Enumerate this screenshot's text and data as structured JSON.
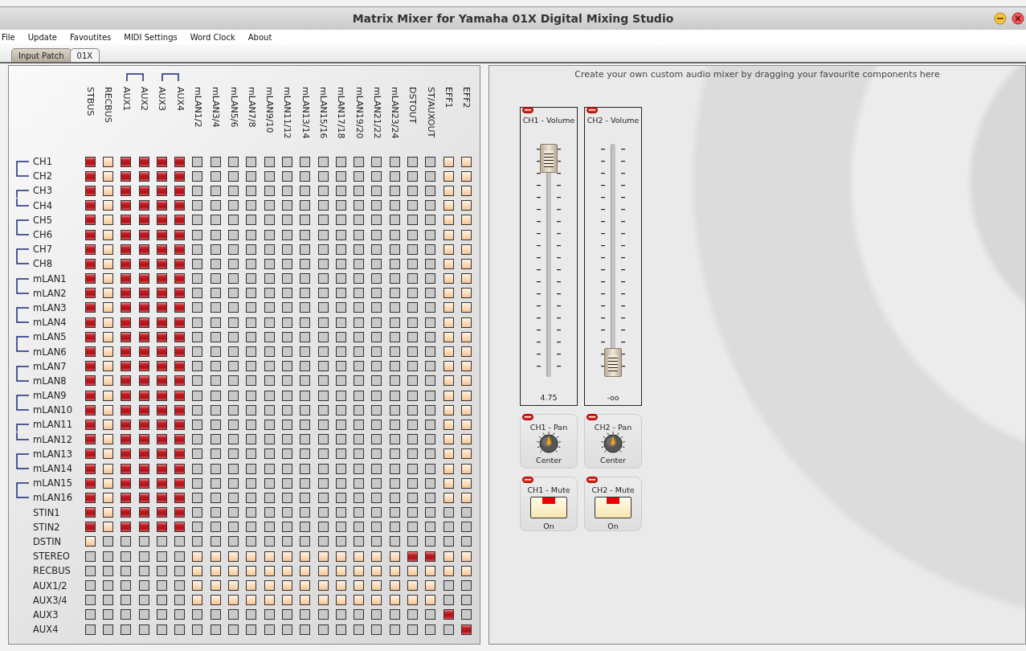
{
  "window": {
    "title": "Matrix Mixer for Yamaha 01X Digital Mixing Studio"
  },
  "menu": [
    "File",
    "Update",
    "Favoutites",
    "MIDI Settings",
    "Word Clock",
    "About"
  ],
  "tabs": [
    {
      "label": "Input Patch",
      "selected": false
    },
    {
      "label": "01X",
      "selected": true
    }
  ],
  "matrix": {
    "columns": [
      {
        "label": "STBUS",
        "linked": false
      },
      {
        "label": "RECBUS",
        "linked": false
      },
      {
        "label": "AUX1",
        "linked": true
      },
      {
        "label": "AUX2",
        "linked": true
      },
      {
        "label": "AUX3",
        "linked": true
      },
      {
        "label": "AUX4",
        "linked": true
      },
      {
        "label": "mLAN1/2",
        "linked": false
      },
      {
        "label": "mLAN3/4",
        "linked": false
      },
      {
        "label": "mLAN5/6",
        "linked": false
      },
      {
        "label": "mLAN7/8",
        "linked": false
      },
      {
        "label": "mLAN9/10",
        "linked": false
      },
      {
        "label": "mLAN11/12",
        "linked": false
      },
      {
        "label": "mLAN13/14",
        "linked": false
      },
      {
        "label": "mLAN15/16",
        "linked": false
      },
      {
        "label": "mLAN17/18",
        "linked": false
      },
      {
        "label": "mLAN19/20",
        "linked": false
      },
      {
        "label": "mLAN21/22",
        "linked": false
      },
      {
        "label": "mLAN23/24",
        "linked": false
      },
      {
        "label": "DSTOUT",
        "linked": false
      },
      {
        "label": "ST/AUXOUT",
        "linked": false
      },
      {
        "label": "EFF1",
        "linked": false
      },
      {
        "label": "EFF2",
        "linked": false
      }
    ],
    "rows": [
      {
        "label": "CH1",
        "linked": true,
        "on": [
          true,
          false,
          true,
          true,
          true,
          true,
          false,
          false,
          false,
          false,
          false,
          false,
          false,
          false,
          false,
          false,
          false,
          false,
          false,
          false,
          false,
          false
        ],
        "enabled": [
          true,
          true,
          true,
          true,
          true,
          true,
          false,
          false,
          false,
          false,
          false,
          false,
          false,
          false,
          false,
          false,
          false,
          false,
          false,
          false,
          true,
          true
        ]
      },
      {
        "label": "CH2",
        "linked": true,
        "on": [
          true,
          false,
          true,
          true,
          true,
          true,
          false,
          false,
          false,
          false,
          false,
          false,
          false,
          false,
          false,
          false,
          false,
          false,
          false,
          false,
          false,
          false
        ],
        "enabled": [
          true,
          true,
          true,
          true,
          true,
          true,
          false,
          false,
          false,
          false,
          false,
          false,
          false,
          false,
          false,
          false,
          false,
          false,
          false,
          false,
          true,
          true
        ]
      },
      {
        "label": "CH3",
        "linked": true,
        "on": [
          true,
          false,
          true,
          true,
          true,
          true,
          false,
          false,
          false,
          false,
          false,
          false,
          false,
          false,
          false,
          false,
          false,
          false,
          false,
          false,
          false,
          false
        ],
        "enabled": [
          true,
          true,
          true,
          true,
          true,
          true,
          false,
          false,
          false,
          false,
          false,
          false,
          false,
          false,
          false,
          false,
          false,
          false,
          false,
          false,
          true,
          true
        ]
      },
      {
        "label": "CH4",
        "linked": true,
        "on": [
          true,
          false,
          true,
          true,
          true,
          true,
          false,
          false,
          false,
          false,
          false,
          false,
          false,
          false,
          false,
          false,
          false,
          false,
          false,
          false,
          false,
          false
        ],
        "enabled": [
          true,
          true,
          true,
          true,
          true,
          true,
          false,
          false,
          false,
          false,
          false,
          false,
          false,
          false,
          false,
          false,
          false,
          false,
          false,
          false,
          true,
          true
        ]
      },
      {
        "label": "CH5",
        "linked": true,
        "on": [
          true,
          false,
          true,
          true,
          true,
          true,
          false,
          false,
          false,
          false,
          false,
          false,
          false,
          false,
          false,
          false,
          false,
          false,
          false,
          false,
          false,
          false
        ],
        "enabled": [
          true,
          true,
          true,
          true,
          true,
          true,
          false,
          false,
          false,
          false,
          false,
          false,
          false,
          false,
          false,
          false,
          false,
          false,
          false,
          false,
          true,
          true
        ]
      },
      {
        "label": "CH6",
        "linked": true,
        "on": [
          true,
          false,
          true,
          true,
          true,
          true,
          false,
          false,
          false,
          false,
          false,
          false,
          false,
          false,
          false,
          false,
          false,
          false,
          false,
          false,
          false,
          false
        ],
        "enabled": [
          true,
          true,
          true,
          true,
          true,
          true,
          false,
          false,
          false,
          false,
          false,
          false,
          false,
          false,
          false,
          false,
          false,
          false,
          false,
          false,
          true,
          true
        ]
      },
      {
        "label": "CH7",
        "linked": true,
        "on": [
          true,
          false,
          true,
          true,
          true,
          true,
          false,
          false,
          false,
          false,
          false,
          false,
          false,
          false,
          false,
          false,
          false,
          false,
          false,
          false,
          false,
          false
        ],
        "enabled": [
          true,
          true,
          true,
          true,
          true,
          true,
          false,
          false,
          false,
          false,
          false,
          false,
          false,
          false,
          false,
          false,
          false,
          false,
          false,
          false,
          true,
          true
        ]
      },
      {
        "label": "CH8",
        "linked": true,
        "on": [
          true,
          false,
          true,
          true,
          true,
          true,
          false,
          false,
          false,
          false,
          false,
          false,
          false,
          false,
          false,
          false,
          false,
          false,
          false,
          false,
          false,
          false
        ],
        "enabled": [
          true,
          true,
          true,
          true,
          true,
          true,
          false,
          false,
          false,
          false,
          false,
          false,
          false,
          false,
          false,
          false,
          false,
          false,
          false,
          false,
          true,
          true
        ]
      },
      {
        "label": "mLAN1",
        "linked": true,
        "on": [
          true,
          false,
          true,
          true,
          true,
          true,
          false,
          false,
          false,
          false,
          false,
          false,
          false,
          false,
          false,
          false,
          false,
          false,
          false,
          false,
          false,
          false
        ],
        "enabled": [
          true,
          true,
          true,
          true,
          true,
          true,
          false,
          false,
          false,
          false,
          false,
          false,
          false,
          false,
          false,
          false,
          false,
          false,
          false,
          false,
          true,
          true
        ]
      },
      {
        "label": "mLAN2",
        "linked": true,
        "on": [
          true,
          false,
          true,
          true,
          true,
          true,
          false,
          false,
          false,
          false,
          false,
          false,
          false,
          false,
          false,
          false,
          false,
          false,
          false,
          false,
          false,
          false
        ],
        "enabled": [
          true,
          true,
          true,
          true,
          true,
          true,
          false,
          false,
          false,
          false,
          false,
          false,
          false,
          false,
          false,
          false,
          false,
          false,
          false,
          false,
          true,
          true
        ]
      },
      {
        "label": "mLAN3",
        "linked": true,
        "on": [
          true,
          false,
          true,
          true,
          true,
          true,
          false,
          false,
          false,
          false,
          false,
          false,
          false,
          false,
          false,
          false,
          false,
          false,
          false,
          false,
          false,
          false
        ],
        "enabled": [
          true,
          true,
          true,
          true,
          true,
          true,
          false,
          false,
          false,
          false,
          false,
          false,
          false,
          false,
          false,
          false,
          false,
          false,
          false,
          false,
          true,
          true
        ]
      },
      {
        "label": "mLAN4",
        "linked": true,
        "on": [
          true,
          false,
          true,
          true,
          true,
          true,
          false,
          false,
          false,
          false,
          false,
          false,
          false,
          false,
          false,
          false,
          false,
          false,
          false,
          false,
          false,
          false
        ],
        "enabled": [
          true,
          true,
          true,
          true,
          true,
          true,
          false,
          false,
          false,
          false,
          false,
          false,
          false,
          false,
          false,
          false,
          false,
          false,
          false,
          false,
          true,
          true
        ]
      },
      {
        "label": "mLAN5",
        "linked": true,
        "on": [
          true,
          false,
          true,
          true,
          true,
          true,
          false,
          false,
          false,
          false,
          false,
          false,
          false,
          false,
          false,
          false,
          false,
          false,
          false,
          false,
          false,
          false
        ],
        "enabled": [
          true,
          true,
          true,
          true,
          true,
          true,
          false,
          false,
          false,
          false,
          false,
          false,
          false,
          false,
          false,
          false,
          false,
          false,
          false,
          false,
          true,
          true
        ]
      },
      {
        "label": "mLAN6",
        "linked": true,
        "on": [
          true,
          false,
          true,
          true,
          true,
          true,
          false,
          false,
          false,
          false,
          false,
          false,
          false,
          false,
          false,
          false,
          false,
          false,
          false,
          false,
          false,
          false
        ],
        "enabled": [
          true,
          true,
          true,
          true,
          true,
          true,
          false,
          false,
          false,
          false,
          false,
          false,
          false,
          false,
          false,
          false,
          false,
          false,
          false,
          false,
          true,
          true
        ]
      },
      {
        "label": "mLAN7",
        "linked": true,
        "on": [
          true,
          false,
          true,
          true,
          true,
          true,
          false,
          false,
          false,
          false,
          false,
          false,
          false,
          false,
          false,
          false,
          false,
          false,
          false,
          false,
          false,
          false
        ],
        "enabled": [
          true,
          true,
          true,
          true,
          true,
          true,
          false,
          false,
          false,
          false,
          false,
          false,
          false,
          false,
          false,
          false,
          false,
          false,
          false,
          false,
          true,
          true
        ]
      },
      {
        "label": "mLAN8",
        "linked": true,
        "on": [
          true,
          false,
          true,
          true,
          true,
          true,
          false,
          false,
          false,
          false,
          false,
          false,
          false,
          false,
          false,
          false,
          false,
          false,
          false,
          false,
          false,
          false
        ],
        "enabled": [
          true,
          true,
          true,
          true,
          true,
          true,
          false,
          false,
          false,
          false,
          false,
          false,
          false,
          false,
          false,
          false,
          false,
          false,
          false,
          false,
          true,
          true
        ]
      },
      {
        "label": "mLAN9",
        "linked": true,
        "on": [
          true,
          false,
          true,
          true,
          true,
          true,
          false,
          false,
          false,
          false,
          false,
          false,
          false,
          false,
          false,
          false,
          false,
          false,
          false,
          false,
          false,
          false
        ],
        "enabled": [
          true,
          true,
          true,
          true,
          true,
          true,
          false,
          false,
          false,
          false,
          false,
          false,
          false,
          false,
          false,
          false,
          false,
          false,
          false,
          false,
          true,
          true
        ]
      },
      {
        "label": "mLAN10",
        "linked": true,
        "on": [
          true,
          false,
          true,
          true,
          true,
          true,
          false,
          false,
          false,
          false,
          false,
          false,
          false,
          false,
          false,
          false,
          false,
          false,
          false,
          false,
          false,
          false
        ],
        "enabled": [
          true,
          true,
          true,
          true,
          true,
          true,
          false,
          false,
          false,
          false,
          false,
          false,
          false,
          false,
          false,
          false,
          false,
          false,
          false,
          false,
          true,
          true
        ]
      },
      {
        "label": "mLAN11",
        "linked": true,
        "on": [
          true,
          false,
          true,
          true,
          true,
          true,
          false,
          false,
          false,
          false,
          false,
          false,
          false,
          false,
          false,
          false,
          false,
          false,
          false,
          false,
          false,
          false
        ],
        "enabled": [
          true,
          true,
          true,
          true,
          true,
          true,
          false,
          false,
          false,
          false,
          false,
          false,
          false,
          false,
          false,
          false,
          false,
          false,
          false,
          false,
          true,
          true
        ]
      },
      {
        "label": "mLAN12",
        "linked": true,
        "on": [
          true,
          false,
          true,
          true,
          true,
          true,
          false,
          false,
          false,
          false,
          false,
          false,
          false,
          false,
          false,
          false,
          false,
          false,
          false,
          false,
          false,
          false
        ],
        "enabled": [
          true,
          true,
          true,
          true,
          true,
          true,
          false,
          false,
          false,
          false,
          false,
          false,
          false,
          false,
          false,
          false,
          false,
          false,
          false,
          false,
          true,
          true
        ]
      },
      {
        "label": "mLAN13",
        "linked": true,
        "on": [
          true,
          false,
          true,
          true,
          true,
          true,
          false,
          false,
          false,
          false,
          false,
          false,
          false,
          false,
          false,
          false,
          false,
          false,
          false,
          false,
          false,
          false
        ],
        "enabled": [
          true,
          true,
          true,
          true,
          true,
          true,
          false,
          false,
          false,
          false,
          false,
          false,
          false,
          false,
          false,
          false,
          false,
          false,
          false,
          false,
          true,
          true
        ]
      },
      {
        "label": "mLAN14",
        "linked": true,
        "on": [
          true,
          false,
          true,
          true,
          true,
          true,
          false,
          false,
          false,
          false,
          false,
          false,
          false,
          false,
          false,
          false,
          false,
          false,
          false,
          false,
          false,
          false
        ],
        "enabled": [
          true,
          true,
          true,
          true,
          true,
          true,
          false,
          false,
          false,
          false,
          false,
          false,
          false,
          false,
          false,
          false,
          false,
          false,
          false,
          false,
          true,
          true
        ]
      },
      {
        "label": "mLAN15",
        "linked": true,
        "on": [
          true,
          false,
          true,
          true,
          true,
          true,
          false,
          false,
          false,
          false,
          false,
          false,
          false,
          false,
          false,
          false,
          false,
          false,
          false,
          false,
          false,
          false
        ],
        "enabled": [
          true,
          true,
          true,
          true,
          true,
          true,
          false,
          false,
          false,
          false,
          false,
          false,
          false,
          false,
          false,
          false,
          false,
          false,
          false,
          false,
          true,
          true
        ]
      },
      {
        "label": "mLAN16",
        "linked": true,
        "on": [
          true,
          false,
          true,
          true,
          true,
          true,
          false,
          false,
          false,
          false,
          false,
          false,
          false,
          false,
          false,
          false,
          false,
          false,
          false,
          false,
          false,
          false
        ],
        "enabled": [
          true,
          true,
          true,
          true,
          true,
          true,
          false,
          false,
          false,
          false,
          false,
          false,
          false,
          false,
          false,
          false,
          false,
          false,
          false,
          false,
          true,
          true
        ]
      },
      {
        "label": "STIN1",
        "linked": false,
        "on": [
          true,
          false,
          true,
          true,
          true,
          true,
          false,
          false,
          false,
          false,
          false,
          false,
          false,
          false,
          false,
          false,
          false,
          false,
          false,
          false,
          false,
          false
        ],
        "enabled": [
          true,
          true,
          true,
          true,
          true,
          true,
          false,
          false,
          false,
          false,
          false,
          false,
          false,
          false,
          false,
          false,
          false,
          false,
          false,
          false,
          false,
          false
        ]
      },
      {
        "label": "STIN2",
        "linked": false,
        "on": [
          true,
          false,
          true,
          true,
          true,
          true,
          false,
          false,
          false,
          false,
          false,
          false,
          false,
          false,
          false,
          false,
          false,
          false,
          false,
          false,
          false,
          false
        ],
        "enabled": [
          true,
          true,
          true,
          true,
          true,
          true,
          false,
          false,
          false,
          false,
          false,
          false,
          false,
          false,
          false,
          false,
          false,
          false,
          false,
          false,
          false,
          false
        ]
      },
      {
        "label": "DSTIN",
        "linked": false,
        "on": [
          false,
          false,
          false,
          false,
          false,
          false,
          false,
          false,
          false,
          false,
          false,
          false,
          false,
          false,
          false,
          false,
          false,
          false,
          false,
          false,
          false,
          false
        ],
        "enabled": [
          true,
          false,
          false,
          false,
          false,
          false,
          false,
          false,
          false,
          false,
          false,
          false,
          false,
          false,
          false,
          false,
          false,
          false,
          false,
          false,
          false,
          false
        ]
      },
      {
        "label": "STEREO",
        "linked": false,
        "on": [
          false,
          false,
          false,
          false,
          false,
          false,
          false,
          false,
          false,
          false,
          false,
          false,
          false,
          false,
          false,
          false,
          false,
          false,
          true,
          true,
          false,
          false
        ],
        "enabled": [
          false,
          false,
          false,
          false,
          false,
          false,
          true,
          true,
          true,
          true,
          true,
          true,
          true,
          true,
          true,
          true,
          true,
          true,
          true,
          true,
          true,
          true
        ]
      },
      {
        "label": "RECBUS",
        "linked": false,
        "on": [
          false,
          false,
          false,
          false,
          false,
          false,
          false,
          false,
          false,
          false,
          false,
          false,
          false,
          false,
          false,
          false,
          false,
          false,
          false,
          false,
          false,
          false
        ],
        "enabled": [
          false,
          false,
          false,
          false,
          false,
          false,
          true,
          true,
          true,
          true,
          true,
          true,
          true,
          true,
          true,
          true,
          true,
          true,
          true,
          true,
          true,
          true
        ]
      },
      {
        "label": "AUX1/2",
        "linked": false,
        "on": [
          false,
          false,
          false,
          false,
          false,
          false,
          false,
          false,
          false,
          false,
          false,
          false,
          false,
          false,
          false,
          false,
          false,
          false,
          false,
          false,
          false,
          false
        ],
        "enabled": [
          false,
          false,
          false,
          false,
          false,
          false,
          true,
          true,
          true,
          true,
          true,
          true,
          true,
          true,
          true,
          true,
          true,
          true,
          true,
          true,
          false,
          false
        ]
      },
      {
        "label": "AUX3/4",
        "linked": false,
        "on": [
          false,
          false,
          false,
          false,
          false,
          false,
          false,
          false,
          false,
          false,
          false,
          false,
          false,
          false,
          false,
          false,
          false,
          false,
          false,
          false,
          false,
          false
        ],
        "enabled": [
          false,
          false,
          false,
          false,
          false,
          false,
          true,
          true,
          true,
          true,
          true,
          true,
          true,
          true,
          true,
          true,
          true,
          true,
          true,
          true,
          false,
          false
        ]
      },
      {
        "label": "AUX3",
        "linked": false,
        "on": [
          false,
          false,
          false,
          false,
          false,
          false,
          false,
          false,
          false,
          false,
          false,
          false,
          false,
          false,
          false,
          false,
          false,
          false,
          false,
          false,
          true,
          false
        ],
        "enabled": [
          false,
          false,
          false,
          false,
          false,
          false,
          false,
          false,
          false,
          false,
          false,
          false,
          false,
          false,
          false,
          false,
          false,
          false,
          false,
          false,
          true,
          false
        ]
      },
      {
        "label": "AUX4",
        "linked": false,
        "on": [
          false,
          false,
          false,
          false,
          false,
          false,
          false,
          false,
          false,
          false,
          false,
          false,
          false,
          false,
          false,
          false,
          false,
          false,
          false,
          false,
          false,
          true
        ],
        "enabled": [
          false,
          false,
          false,
          false,
          false,
          false,
          false,
          false,
          false,
          false,
          false,
          false,
          false,
          false,
          false,
          false,
          false,
          false,
          false,
          false,
          false,
          true
        ]
      }
    ]
  },
  "mixer": {
    "hint": "Create your own custom audio mixer by dragging your favourite components here",
    "faders": [
      {
        "label": "CH1 - Volume",
        "level": 0.97,
        "reading": "4.75"
      },
      {
        "label": "CH2 - Volume",
        "level": 0,
        "reading": "-oo"
      }
    ],
    "pans": [
      {
        "label": "CH1 - Pan",
        "reading": "Center"
      },
      {
        "label": "CH2 - Pan",
        "reading": "Center"
      }
    ],
    "mutes": [
      {
        "label": "CH1 - Mute",
        "on": true,
        "reading": "On"
      },
      {
        "label": "CH2 - Mute",
        "on": true,
        "reading": "On"
      }
    ]
  }
}
